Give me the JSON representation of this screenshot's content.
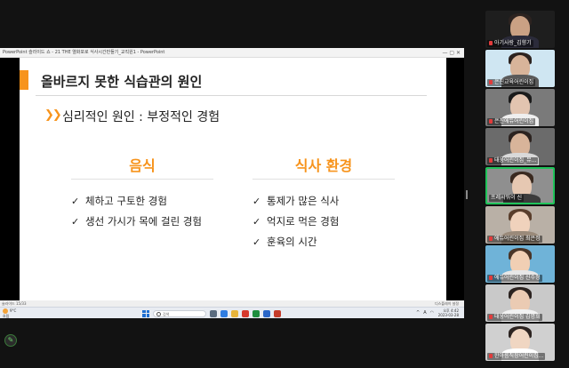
{
  "ppt": {
    "title_text": "PowerPoint 슬라이드 쇼 - 21 THE 열화포로 식사시간만들기_교직원1 - PowerPoint",
    "status_left": "슬라이드 15/33",
    "status_right": "디스플레이 설정"
  },
  "slide": {
    "title": "올바르지 못한 식습관의 원인",
    "chevron": "❯❯",
    "subtitle": "심리적인 원인 : 부정적인 경험",
    "left_heading": "음식",
    "left_items": [
      "체하고 구토한 경험",
      "생선 가시가 목에 걸린 경험"
    ],
    "right_heading": "식사 환경",
    "right_items": [
      "통제가 많은 식사",
      "억지로 먹은 경험",
      "훈육의 시간"
    ],
    "check_glyph": "✓"
  },
  "taskbar": {
    "weather_temp": "9°C",
    "weather_desc": "흐림",
    "search_placeholder": "검색",
    "tray_lang": "A",
    "clock_time": "오후 4:42",
    "clock_date": "2023-03-28"
  },
  "participants": [
    {
      "name": "아기사랑_김향기"
    },
    {
      "name": "은진교육어린이집"
    },
    {
      "name": "은진에듀어린이집"
    },
    {
      "name": "태웅어린이집_뮤..."
    },
    {
      "name": "프레시워이 신"
    },
    {
      "name": "에듀어린이집 최은정"
    },
    {
      "name": "에듀어린이집 신수정"
    },
    {
      "name": "태웅어린이집 김명희"
    },
    {
      "name": "한아름직장어린이집..."
    }
  ],
  "colors": {
    "accent": "#f7941d",
    "active_speaker": "#20c35a"
  }
}
